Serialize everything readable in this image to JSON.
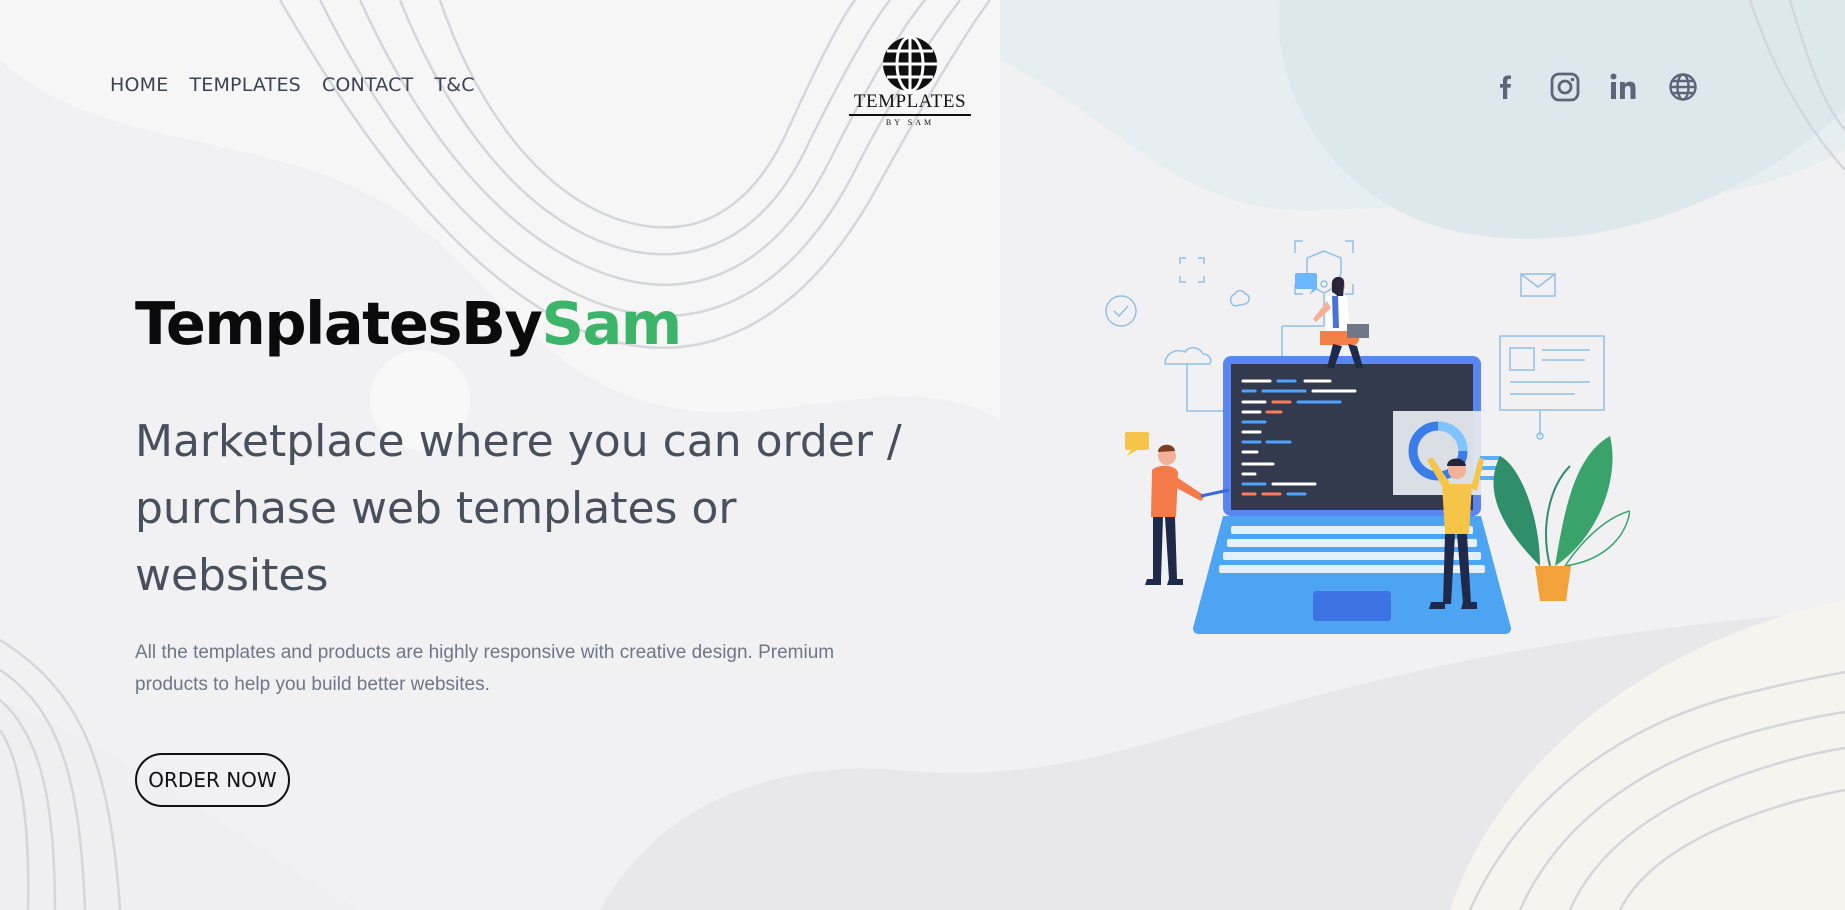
{
  "nav": {
    "items": [
      "HOME",
      "TEMPLATES",
      "CONTACT",
      "T&C"
    ]
  },
  "logo": {
    "title": "TEMPLATES",
    "subtitle": "BY SAM",
    "icon": "globe-icon"
  },
  "social": {
    "icons": [
      "facebook-icon",
      "instagram-icon",
      "linkedin-icon",
      "globe-icon"
    ]
  },
  "hero": {
    "brand_part1": "TemplatesBy",
    "brand_part2": "Sam",
    "headline": "Marketplace where you can order / purchase web templates or websites",
    "description": "All the templates and products are highly responsive with creative design. Premium products to help you build better websites.",
    "cta_label": "ORDER NOW"
  },
  "colors": {
    "accent_green": "#3cb56a",
    "text_dark": "#0b0b0b",
    "text_gray": "#48505e",
    "laptop_blue": "#4a8ff0"
  }
}
